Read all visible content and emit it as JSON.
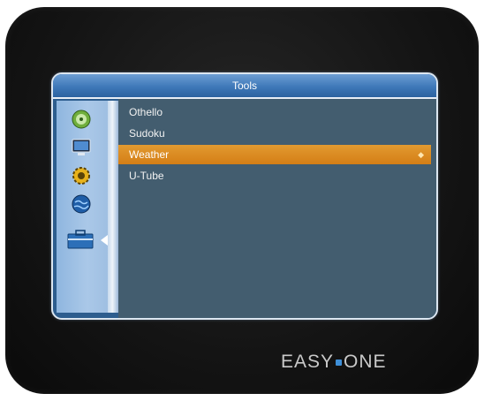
{
  "window": {
    "title": "Tools"
  },
  "sidebar": {
    "items": [
      {
        "icon": "disc-icon"
      },
      {
        "icon": "monitor-icon"
      },
      {
        "icon": "gear-icon"
      },
      {
        "icon": "globe-icon"
      },
      {
        "icon": "toolbox-icon",
        "active": true
      }
    ]
  },
  "menu": {
    "items": [
      {
        "label": "Othello"
      },
      {
        "label": "Sudoku"
      },
      {
        "label": "Weather",
        "selected": true
      },
      {
        "label": "U-Tube"
      }
    ],
    "selected_index": 2
  },
  "brand": {
    "left": "EASY",
    "right": "ONE"
  },
  "colors": {
    "screen_bg": "#2d5d8e",
    "content_bg": "#435d6f",
    "selection": "#e29a30",
    "bezel": "#141414",
    "logo_dot": "#3e8fd8"
  }
}
